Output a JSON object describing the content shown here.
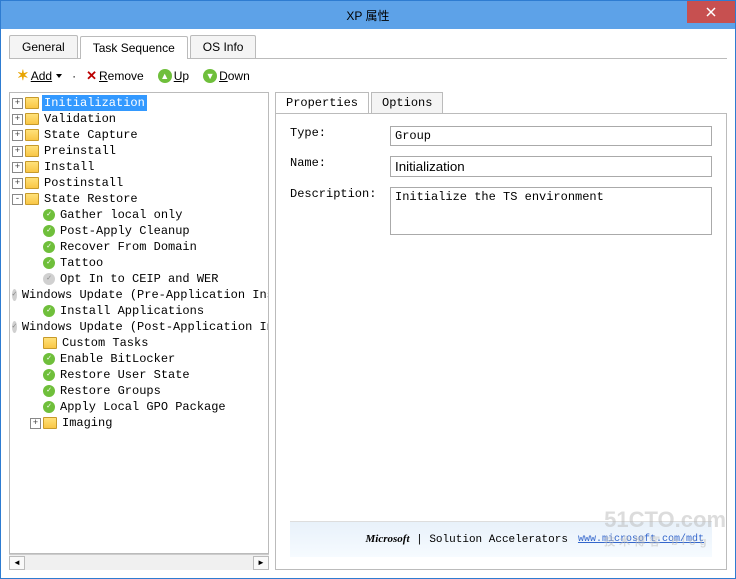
{
  "window": {
    "title": "XP 属性"
  },
  "tabs": {
    "items": [
      "General",
      "Task Sequence",
      "OS Info"
    ],
    "active": 1
  },
  "toolbar": {
    "add": "Add",
    "remove": "Remove",
    "up": "Up",
    "down": "Down"
  },
  "tree": {
    "selected": "Initialization",
    "nodes": [
      {
        "label": "Initialization",
        "depth": 0,
        "kind": "folder",
        "exp": "+",
        "selected": true
      },
      {
        "label": "Validation",
        "depth": 0,
        "kind": "folder",
        "exp": "+"
      },
      {
        "label": "State Capture",
        "depth": 0,
        "kind": "folder",
        "exp": "+"
      },
      {
        "label": "Preinstall",
        "depth": 0,
        "kind": "folder",
        "exp": "+"
      },
      {
        "label": "Install",
        "depth": 0,
        "kind": "folder",
        "exp": "+"
      },
      {
        "label": "Postinstall",
        "depth": 0,
        "kind": "folder",
        "exp": "+"
      },
      {
        "label": "State Restore",
        "depth": 0,
        "kind": "folder",
        "exp": "-"
      },
      {
        "label": "Gather local only",
        "depth": 1,
        "kind": "ok"
      },
      {
        "label": "Post-Apply Cleanup",
        "depth": 1,
        "kind": "ok"
      },
      {
        "label": "Recover From Domain",
        "depth": 1,
        "kind": "ok"
      },
      {
        "label": "Tattoo",
        "depth": 1,
        "kind": "ok"
      },
      {
        "label": "Opt In to CEIP and WER",
        "depth": 1,
        "kind": "off"
      },
      {
        "label": "Windows Update (Pre-Application Installation)",
        "depth": 1,
        "kind": "off"
      },
      {
        "label": "Install Applications",
        "depth": 1,
        "kind": "ok"
      },
      {
        "label": "Windows Update (Post-Application Installation)",
        "depth": 1,
        "kind": "off"
      },
      {
        "label": "Custom Tasks",
        "depth": 1,
        "kind": "folder",
        "exp": ""
      },
      {
        "label": "Enable BitLocker",
        "depth": 1,
        "kind": "ok"
      },
      {
        "label": "Restore User State",
        "depth": 1,
        "kind": "ok"
      },
      {
        "label": "Restore Groups",
        "depth": 1,
        "kind": "ok"
      },
      {
        "label": "Apply Local GPO Package",
        "depth": 1,
        "kind": "ok"
      },
      {
        "label": "Imaging",
        "depth": 1,
        "kind": "folder",
        "exp": "+"
      }
    ]
  },
  "innerTabs": {
    "items": [
      "Properties",
      "Options"
    ],
    "active": 0
  },
  "props": {
    "typeLabel": "Type:",
    "typeValue": "Group",
    "nameLabel": "Name:",
    "nameValue": "Initialization",
    "descLabel": "Description:",
    "descValue": "Initialize the TS environment"
  },
  "footer": {
    "brand": "Microsoft",
    "brandSuffix": " | Solution Accelerators",
    "link": "www.microsoft.com/mdt"
  },
  "watermark": {
    "line1": "51CTO.com",
    "line2": "技术博客 blog"
  }
}
